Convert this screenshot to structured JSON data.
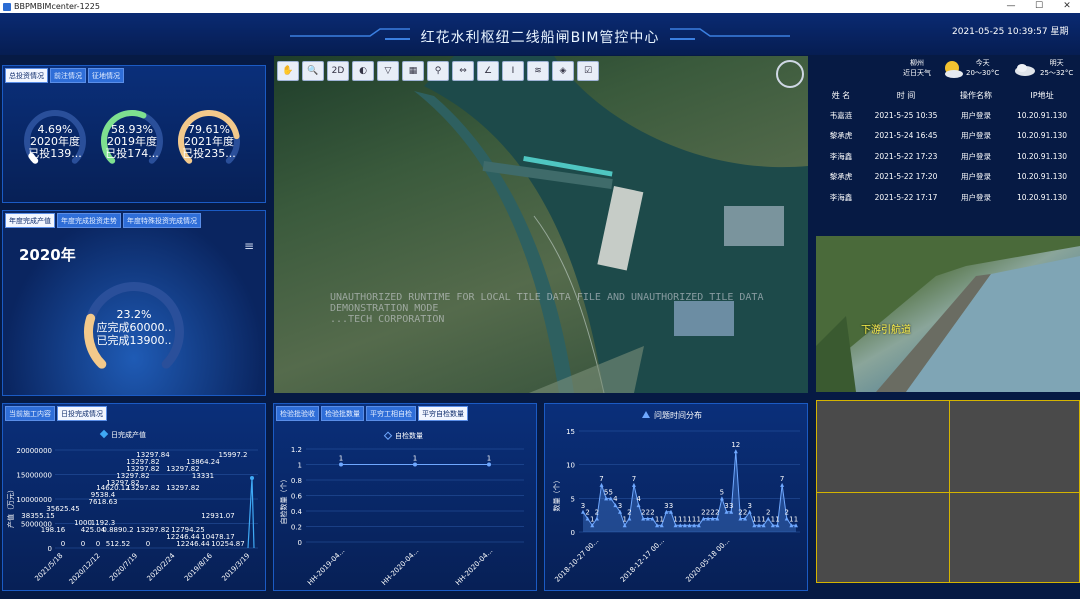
{
  "window": {
    "title": "BBPMBIMcenter-1225"
  },
  "header": {
    "title": "红花水利枢纽二线船闸BIM管控中心",
    "datetime": "2021-05-25  10:39:57  星期"
  },
  "weather": {
    "city": "柳州",
    "city_desc": "近日天气",
    "today_label": "今天",
    "today_temp": "20～30°C",
    "tomorrow_label": "明天",
    "tomorrow_temp": "25～32°C"
  },
  "investment": {
    "tabs": [
      "总投资情况",
      "前注情况",
      "征地情况"
    ],
    "gauges": [
      {
        "pct": "4.69%",
        "year": "2020年度",
        "note": "已投139...",
        "value": 0.0469,
        "color": "#ffffff"
      },
      {
        "pct": "58.93%",
        "year": "2019年度",
        "note": "已投174...",
        "value": 0.5893,
        "color": "#7ee08f"
      },
      {
        "pct": "79.61%",
        "year": "2021年度",
        "note": "已投235...",
        "value": 0.7961,
        "color": "#f3c98b"
      }
    ]
  },
  "annual": {
    "tabs": [
      "年度完成产值",
      "年度完成投资走势",
      "年度特殊投资完成情况"
    ],
    "year": "2020年",
    "menu_icon": "hamburger-icon",
    "gauge": {
      "pct": "23.2%",
      "due": "应完成60000..",
      "done": "已完成13900..",
      "value": 0.232,
      "color": "#f3c98b"
    }
  },
  "toolbar": {
    "tools": [
      {
        "icon": "hand-icon",
        "glyph": "✋"
      },
      {
        "icon": "zoom-icon",
        "glyph": "🔍"
      },
      {
        "icon": "2d-icon",
        "glyph": "2D"
      },
      {
        "icon": "globe-icon",
        "glyph": "◐"
      },
      {
        "icon": "triangle-icon",
        "glyph": "▽"
      },
      {
        "icon": "grid-icon",
        "glyph": "▦"
      },
      {
        "icon": "pin-icon",
        "glyph": "⚲"
      },
      {
        "icon": "measure-icon",
        "glyph": "⇔"
      },
      {
        "icon": "angle-icon",
        "glyph": "∠"
      },
      {
        "icon": "text-icon",
        "glyph": "I"
      },
      {
        "icon": "layers-icon",
        "glyph": "≋"
      },
      {
        "icon": "cube-icon",
        "glyph": "◈"
      },
      {
        "icon": "check-icon",
        "glyph": "☑"
      }
    ]
  },
  "map": {
    "watermark": [
      "UNAUTHORIZED RUNTIME FOR LOCAL TILE DATA FILE AND UNAUTHORIZED TILE DATA",
      "DEMONSTRATION MODE",
      "...TECH CORPORATION"
    ]
  },
  "log": {
    "headers": [
      "姓 名",
      "时 间",
      "操作名称",
      "IP地址"
    ],
    "rows": [
      [
        "韦嘉涟",
        "2021-5-25 10:35",
        "用户登录",
        "10.20.91.130"
      ],
      [
        "黎承虎",
        "2021-5-24 16:45",
        "用户登录",
        "10.20.91.130"
      ],
      [
        "李海鑫",
        "2021-5-22 17:23",
        "用户登录",
        "10.20.91.130"
      ],
      [
        "黎承虎",
        "2021-5-22 17:20",
        "用户登录",
        "10.20.91.130"
      ],
      [
        "李海鑫",
        "2021-5-22 17:17",
        "用户登录",
        "10.20.91.130"
      ]
    ]
  },
  "video": {
    "label": "下游引航道"
  },
  "output": {
    "tabs": [
      "当前施工内容",
      "日投完成情况"
    ],
    "legend": "日完成产值",
    "ylabel": "产值（万元）",
    "yticks": [
      "20000000",
      "15000000",
      "10000000",
      "5000000",
      "0"
    ],
    "xticks": [
      "2021/5/18",
      "2020/12/12",
      "2020/7/19",
      "2020/2/24",
      "2019/8/16",
      "2019/3/19"
    ],
    "labels": [
      "13297.84",
      "13297.82",
      "13297.82",
      "13297.82",
      "13297.82",
      "13297.82",
      "15997.2",
      "13864.24",
      "13331",
      "14620.12",
      "9538.4",
      "7618.63",
      "35625.45",
      "13297.82",
      "13297.82",
      "12931.07",
      "38355.15",
      "1000",
      "1192.3",
      "13297.82",
      "12794.25",
      "198.16",
      "425.04",
      "0.8890.2",
      "12246.44",
      "10478.17",
      "0",
      "0",
      "0",
      "512.52",
      "0",
      "12246.44",
      "10254.87"
    ]
  },
  "inspect_tabs": [
    "检验批验收",
    "检验批数量",
    "平穷工相自检",
    "平穷自检数量"
  ],
  "chart_data": [
    {
      "type": "line",
      "title": "自检数量",
      "categories": [
        "HH-2019-04...",
        "HH-2020-04...",
        "HH-2020-04..."
      ],
      "values": [
        1,
        1,
        1
      ],
      "xlabel": "",
      "ylabel": "自检数量（个）",
      "ylim": [
        0,
        1.2
      ],
      "yticks": [
        0,
        0.2,
        0.4,
        0.6,
        0.8,
        1,
        1.2
      ]
    },
    {
      "type": "line",
      "title": "问题时间分布",
      "xticks": [
        "2018-10-27 00...",
        "2018-12-17 00...",
        "2020-05-18 00..."
      ],
      "ylabel": "数量（个）",
      "ylim": [
        0,
        15
      ],
      "yticks": [
        0,
        5,
        10,
        15
      ],
      "values": [
        3,
        2,
        1,
        2,
        7,
        5,
        5,
        4,
        3,
        1,
        2,
        7,
        4,
        2,
        2,
        2,
        1,
        1,
        3,
        3,
        1,
        1,
        1,
        1,
        1,
        1,
        2,
        2,
        2,
        2,
        5,
        3,
        3,
        12,
        2,
        2,
        3,
        1,
        1,
        1,
        2,
        1,
        1,
        7,
        2,
        1,
        1
      ]
    }
  ],
  "colors": {
    "bg": "#061a44",
    "panel": "#0a2f7a",
    "accent": "#3b7fe0",
    "gauge_gold": "#f3c98b",
    "gauge_green": "#7ee08f"
  }
}
